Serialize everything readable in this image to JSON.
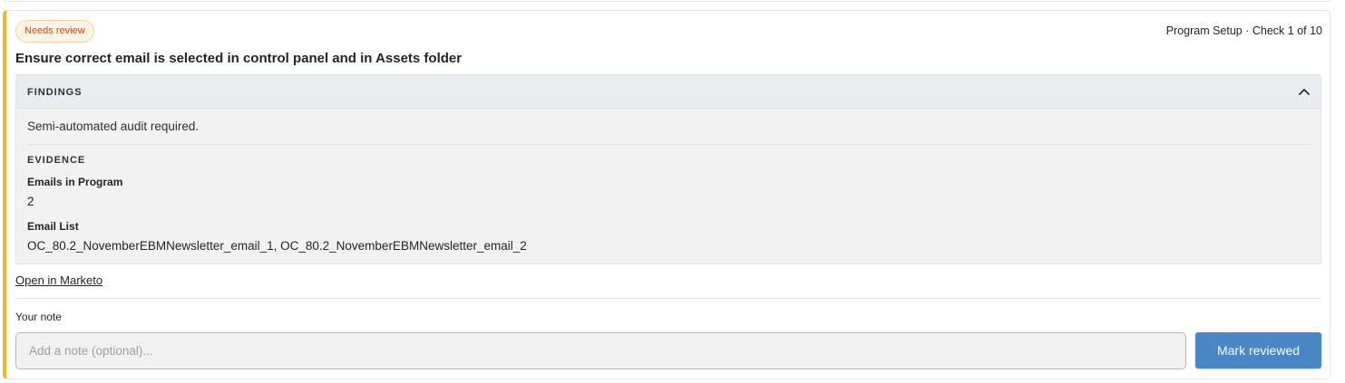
{
  "check": {
    "status_badge": "Needs review",
    "meta": "Program Setup · Check 1 of 10",
    "title": "Ensure correct email is selected in control panel and in Assets folder"
  },
  "findings": {
    "header": "FINDINGS",
    "toggle_icon": "chevron-up-icon",
    "summary": "Semi-automated audit required.",
    "evidence_label": "EVIDENCE",
    "evidence": [
      {
        "key": "Emails in Program",
        "value": "2"
      },
      {
        "key": "Email List",
        "value": "OC_80.2_NovemberEBMNewsletter_email_1, OC_80.2_NovemberEBMNewsletter_email_2"
      }
    ]
  },
  "actions": {
    "open_link": "Open in Marketo",
    "note_label": "Your note",
    "note_value": "",
    "note_placeholder": "Add a note (optional)...",
    "mark_button": "Mark reviewed"
  },
  "colors": {
    "accent_border": "#f0b429",
    "badge_text": "#d9480f",
    "primary_button": "#4a86c5"
  }
}
